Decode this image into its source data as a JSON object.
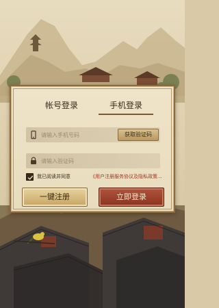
{
  "tabs": {
    "account_label": "帐号登录",
    "phone_label": "手机登录",
    "active": "phone"
  },
  "phone_field": {
    "placeholder": "请输入手机号码",
    "icon": "phone-icon"
  },
  "code_field": {
    "placeholder": "请输入验证码",
    "icon": "lock-icon",
    "get_code_label": "获取验证码"
  },
  "agreement": {
    "checked": true,
    "text": "我已阅读并同意",
    "link_text": "《用户注册服务协议及隐私政策..."
  },
  "buttons": {
    "register_label": "一键注册",
    "login_label": "立即登录"
  },
  "colors": {
    "panel": "#efe4c9",
    "register_button": "#d8bf80",
    "login_button": "#9c402b",
    "link": "#9a3a22"
  }
}
